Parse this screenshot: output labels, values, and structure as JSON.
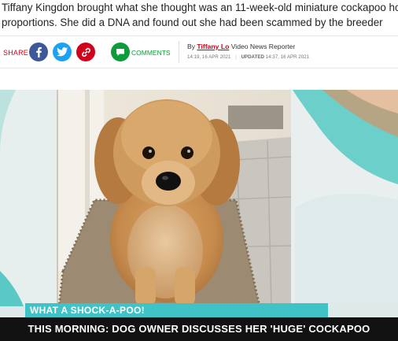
{
  "article": {
    "standfirst_line1": "Tiffany Kingdon brought what she thought was an 11-week-old miniature cockapoo ho",
    "standfirst_line2": "proportions. She did a DNA and found out she had been scammed by the breeder"
  },
  "share": {
    "label": "SHARE",
    "buttons": [
      "facebook-icon",
      "twitter-icon",
      "link-icon"
    ],
    "comments_label": "COMMENTS"
  },
  "byline": {
    "prefix": "By",
    "author": "Tiffany Lo",
    "role": "Video News Reporter",
    "published": "14:19, 16 APR 2021",
    "pipe": "|",
    "updated_label": "UPDATED",
    "updated": "14:37, 16 APR 2021"
  },
  "video": {
    "ticker": "WHAT A SHOCK-A-POO!",
    "caption": "THIS MORNING: DOG OWNER DISCUSSES HER 'HUGE' COCKAPOO"
  },
  "colors": {
    "accent_red": "#d0021b",
    "facebook": "#3b5998",
    "twitter": "#1da1f2",
    "comments_green": "#0e9b3a",
    "ticker_teal": "#3fc3c6",
    "caption_bg": "#121212"
  }
}
